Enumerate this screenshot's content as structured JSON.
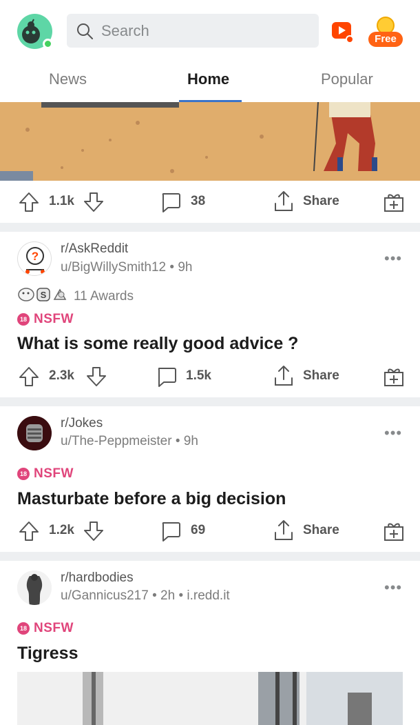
{
  "header": {
    "search_placeholder": "Search",
    "free_label": "Free"
  },
  "tabs": [
    {
      "label": "News"
    },
    {
      "label": "Home"
    },
    {
      "label": "Popular"
    }
  ],
  "first_post_actions": {
    "score": "1.1k",
    "comments": "38",
    "share_label": "Share"
  },
  "posts": [
    {
      "subreddit": "r/AskReddit",
      "user": "u/BigWillySmith12",
      "time": "9h",
      "awards": "11 Awards",
      "nsfw": "NSFW",
      "title": "What is some really good advice ?",
      "score": "2.3k",
      "comments": "1.5k",
      "share_label": "Share"
    },
    {
      "subreddit": "r/Jokes",
      "user": "u/The-Peppmeister",
      "time": "9h",
      "nsfw": "NSFW",
      "title": "Masturbate before a big decision",
      "score": "1.2k",
      "comments": "69",
      "share_label": "Share"
    },
    {
      "subreddit": "r/hardbodies",
      "user": "u/Gannicus217",
      "time": "2h",
      "domain": "i.redd.it",
      "nsfw": "NSFW",
      "title": "Tigress"
    }
  ],
  "colors": {
    "accent_blue": "#3a73c9",
    "nsfw_pink": "#e0457b",
    "free_orange": "#ff6314",
    "divider_gray": "#edeff1"
  }
}
